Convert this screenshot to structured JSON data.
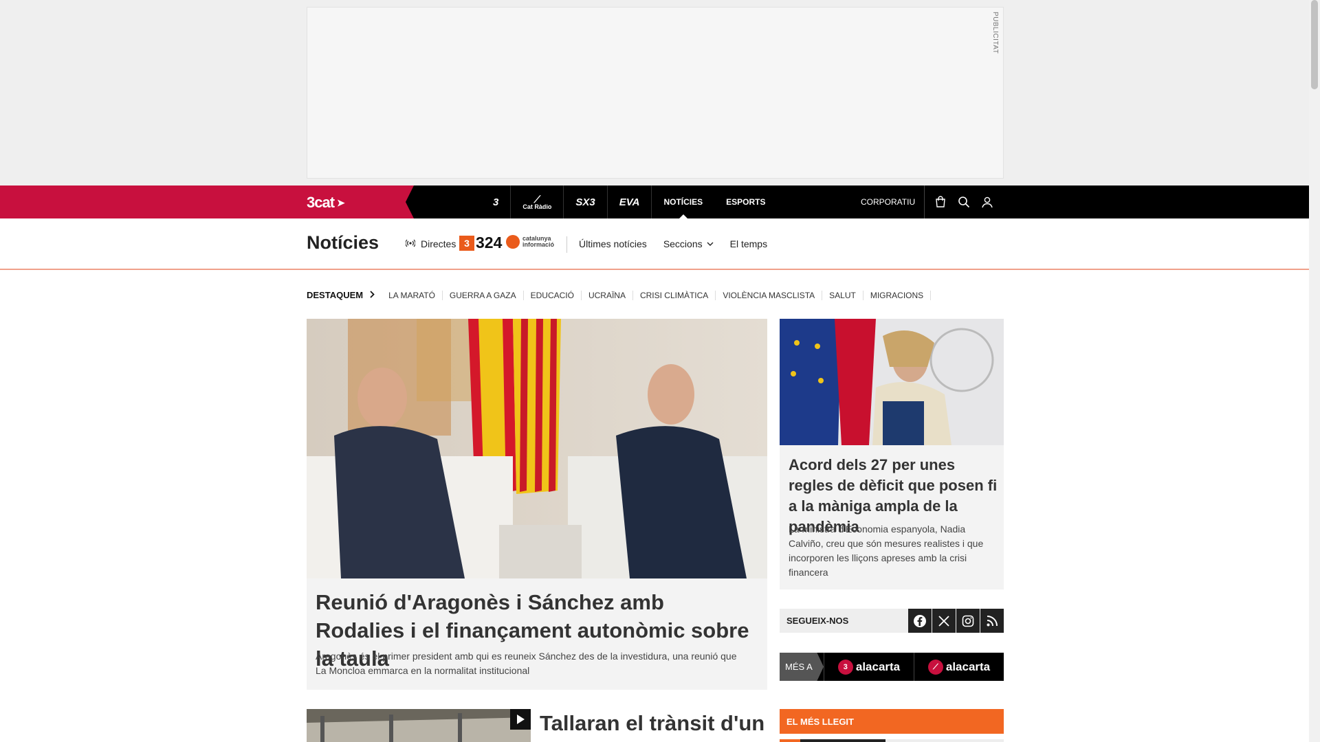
{
  "ad": {
    "label": "PUBLICITAT"
  },
  "topnav": {
    "brand": "3cat",
    "channels": [
      "3",
      "Cat Ràdio",
      "SX3",
      "EVA"
    ],
    "links": [
      "NOTÍCIES",
      "ESPORTS"
    ],
    "active": "NOTÍCIES",
    "corporate": "CORPORATIU",
    "icons": [
      "shop-icon",
      "search-icon",
      "user-icon"
    ]
  },
  "section": {
    "title": "Notícies",
    "live_label": "Directes",
    "logo_324": "324",
    "logo_ci": "catalunya informació",
    "links": [
      "Últimes notícies",
      "Seccions",
      "El temps"
    ]
  },
  "featured": {
    "label": "DESTAQUEM",
    "tags": [
      "LA MARATÓ",
      "GUERRA A GAZA",
      "EDUCACIÓ",
      "UCRAÏNA",
      "CRISI CLIMÀTICA",
      "VIOLÈNCIA MASCLISTA",
      "SALUT",
      "MIGRACIONS"
    ]
  },
  "main_article": {
    "title": "Reunió d'Aragonès i Sánchez amb Rodalies i el finançament autonòmic sobre la taula",
    "summary": "Aragonès és el primer president amb qui es reuneix Sánchez des de la investidura, una reunió que La Moncloa emmarca en la normalitat institucional"
  },
  "side_article": {
    "title": "Acord dels 27 per unes regles de dèficit que posen fi a la màniga ampla de la pandèmia",
    "summary": "La ministra d'Economia espanyola, Nadia Calviño, creu que són mesures realistes i que incorporen les lliçons apreses amb la crisi financera"
  },
  "follow": {
    "label": "SEGUEIX-NOS",
    "networks": [
      "facebook-icon",
      "x-icon",
      "instagram-icon",
      "rss-icon"
    ]
  },
  "more": {
    "label": "MÉS A",
    "items": [
      {
        "badge": "3",
        "text": "alacarta"
      },
      {
        "badge": "",
        "text": "alacarta"
      }
    ]
  },
  "bottom_article": {
    "title": "Tallaran el trànsit d'un"
  },
  "most_read": {
    "label": "EL MÉS LLEGIT"
  },
  "colors": {
    "brand_red": "#c8103e",
    "orange": "#f26722",
    "dark": "#000000"
  }
}
